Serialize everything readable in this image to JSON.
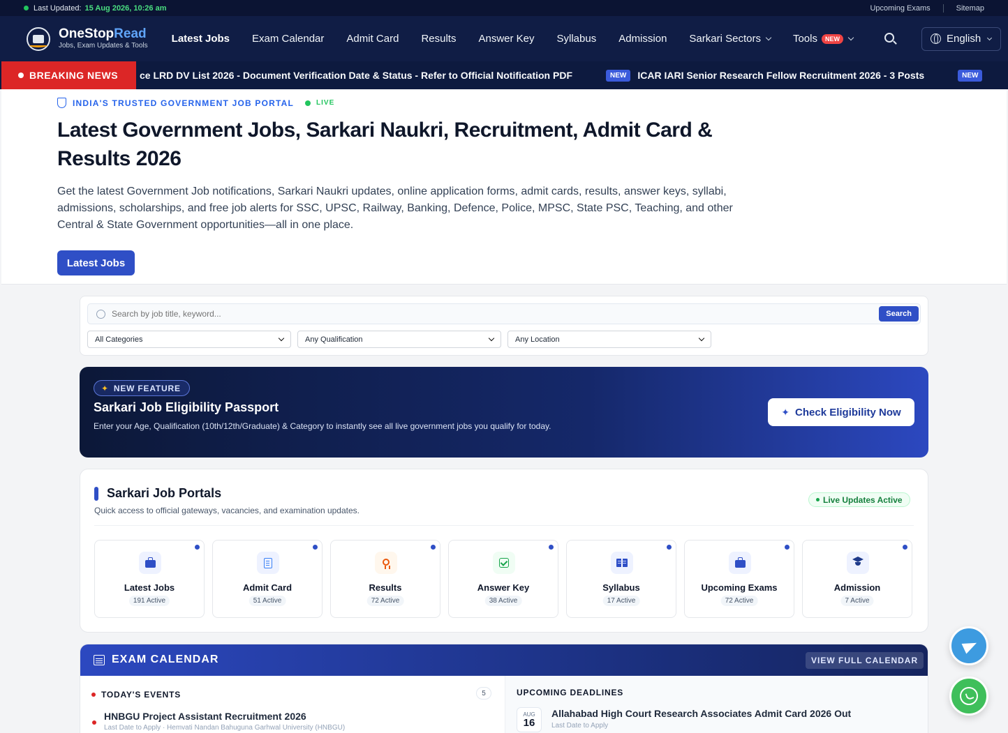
{
  "topbar": {
    "updated_label": "Last Updated:",
    "updated_value": "15 Aug 2026, 10:26 am",
    "links": [
      "Upcoming Exams",
      "Sitemap"
    ]
  },
  "brand": {
    "name_a": "OneStop",
    "name_b": "Read",
    "tagline": "Jobs, Exam Updates & Tools"
  },
  "nav": {
    "items": [
      "Latest Jobs",
      "Exam Calendar",
      "Admit Card",
      "Results",
      "Answer Key",
      "Syllabus",
      "Admission"
    ],
    "sectors": "Sarkari Sectors",
    "tools": "Tools",
    "tools_badge": "NEW",
    "language": "English"
  },
  "ticker": {
    "label": "BREAKING NEWS",
    "item1": "ce LRD DV List 2026 - Document Verification Date & Status - Refer to Official Notification PDF",
    "item2_badge": "NEW",
    "item2": "ICAR IARI Senior Research Fellow Recruitment 2026 - 3 Posts",
    "item3_badge": "NEW"
  },
  "hero": {
    "eyebrow": "INDIA'S TRUSTED GOVERNMENT JOB PORTAL",
    "live": "LIVE",
    "title": "Latest Government Jobs, Sarkari Naukri, Recruitment, Admit Card & Results 2026",
    "description": "Get the latest Government Job notifications, Sarkari Naukri updates, online application forms, admit cards, results, answer keys, syllabi, admissions, scholarships, and free job alerts for SSC, UPSC, Railway, Banking, Defence, Police, MPSC, State PSC, Teaching, and other Central & State Government opportunities—all in one place.",
    "cta": "Latest Jobs"
  },
  "search": {
    "placeholder": "Search by job title, keyword...",
    "button": "Search",
    "category": "All Categories",
    "qualification": "Any Qualification",
    "location": "Any Location"
  },
  "feature": {
    "pill": "NEW FEATURE",
    "title": "Sarkari Job Eligibility Passport",
    "description": "Enter your Age, Qualification (10th/12th/Graduate) & Category to instantly see all live government jobs you qualify for today.",
    "button": "Check Eligibility Now"
  },
  "portals": {
    "title": "Sarkari Job Portals",
    "subtitle": "Quick access to official gateways, vacancies, and examination updates.",
    "live_badge": "Live Updates Active",
    "cards": [
      {
        "name": "Latest Jobs",
        "count": "191 Active",
        "icon": "briefcase-icon"
      },
      {
        "name": "Admit Card",
        "count": "51 Active",
        "icon": "document-icon"
      },
      {
        "name": "Results",
        "count": "72 Active",
        "icon": "award-icon"
      },
      {
        "name": "Answer Key",
        "count": "38 Active",
        "icon": "check-square-icon"
      },
      {
        "name": "Syllabus",
        "count": "17 Active",
        "icon": "book-icon"
      },
      {
        "name": "Upcoming Exams",
        "count": "72 Active",
        "icon": "briefcase-icon"
      },
      {
        "name": "Admission",
        "count": "7 Active",
        "icon": "graduation-cap-icon"
      }
    ]
  },
  "calendar": {
    "title": "EXAM CALENDAR",
    "view_all": "VIEW FULL CALENDAR",
    "today_label": "TODAY'S EVENTS",
    "today_count": "5",
    "today_event": {
      "title": "HNBGU Project Assistant Recruitment 2026",
      "meta": "Last Date to Apply · Hemvati Nandan Bahuguna Garhwal University (HNBGU)"
    },
    "upcoming_label": "UPCOMING DEADLINES",
    "upcoming_event": {
      "month": "AUG",
      "day": "16",
      "title": "Allahabad High Court Research Associates Admit Card 2026 Out",
      "meta": "Last Date to Apply"
    }
  },
  "colors": {
    "navy": "#101d45",
    "primary": "#2f4fc6",
    "breaking": "#dc2626",
    "live": "#22c55e"
  }
}
